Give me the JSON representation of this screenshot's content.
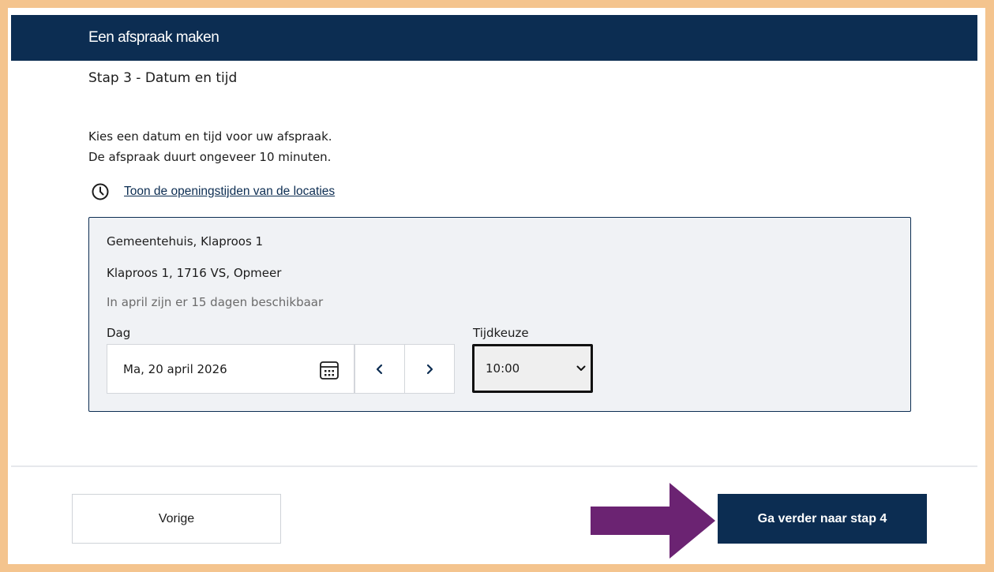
{
  "header": {
    "title": "Een afspraak maken"
  },
  "step": {
    "title": "Stap 3 - Datum en tijd"
  },
  "intro": {
    "line1": "Kies een datum en tijd voor uw afspraak.",
    "line2": "De afspraak duurt ongeveer 10 minuten."
  },
  "hours_link": {
    "label": "Toon de openingstijden van de locaties",
    "icon": "clock-icon"
  },
  "location": {
    "name": "Gemeentehuis, Klaproos 1",
    "address": "Klaproos 1, 1716 VS, Opmeer",
    "availability": "In april zijn er 15 dagen beschikbaar"
  },
  "date_field": {
    "label": "Dag",
    "value": "Ma, 20 april 2026",
    "icon": "calendar-icon"
  },
  "time_field": {
    "label": "Tijdkeuze",
    "value": "10:00"
  },
  "nav": {
    "prev_icon": "chevron-left-icon",
    "next_icon": "chevron-right-icon"
  },
  "footer": {
    "prev_label": "Vorige",
    "next_label": "Ga verder naar stap 4"
  },
  "colors": {
    "brand": "#0c2d52",
    "page_border": "#f4c48e",
    "annotation_arrow": "#6b2372",
    "box_background": "#f0f2f5"
  }
}
